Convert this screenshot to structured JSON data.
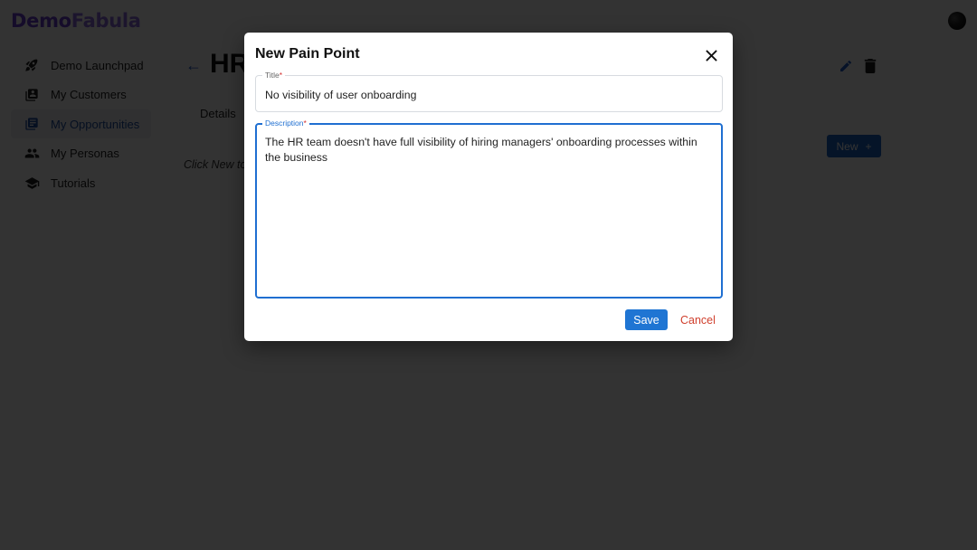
{
  "app": {
    "logo_part1": "Demo",
    "logo_part2": "Fabula"
  },
  "sidebar": {
    "items": [
      {
        "label": "Demo Launchpad",
        "icon": "rocket-icon",
        "active": false
      },
      {
        "label": "My Customers",
        "icon": "contacts-book-icon",
        "active": false
      },
      {
        "label": "My Opportunities",
        "icon": "library-books-icon",
        "active": true
      },
      {
        "label": "My Personas",
        "icon": "people-icon",
        "active": false
      },
      {
        "label": "Tutorials",
        "icon": "school-icon",
        "active": false
      }
    ]
  },
  "page": {
    "title": "HR",
    "tabs": [
      {
        "label": "Details"
      }
    ],
    "hint": "Click New to",
    "new_button": {
      "label": "New",
      "icon": "plus-icon"
    }
  },
  "dialog": {
    "title": "New Pain Point",
    "fields": {
      "title": {
        "label": "Title",
        "required_mark": "*",
        "value": "No visibility of user onboarding"
      },
      "description": {
        "label": "Description",
        "required_mark": "*",
        "value": "The HR team doesn't have full visibility of hiring managers' onboarding processes within the business"
      }
    },
    "save_label": "Save",
    "cancel_label": "Cancel"
  },
  "colors": {
    "primary": "#1f75d3",
    "cancel": "#d0402e",
    "brand": "#6a3fd0"
  }
}
